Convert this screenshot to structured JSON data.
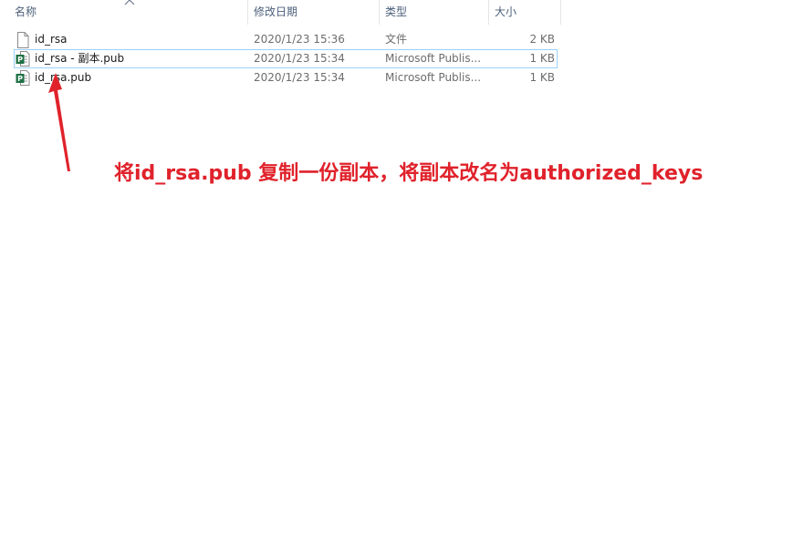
{
  "columns": {
    "name": "名称",
    "modified": "修改日期",
    "type": "类型",
    "size": "大小"
  },
  "files": [
    {
      "name": "id_rsa",
      "modified": "2020/1/23 15:36",
      "type": "文件",
      "size": "2 KB",
      "icon": "generic-file-icon",
      "selected": false
    },
    {
      "name": "id_rsa - 副本.pub",
      "modified": "2020/1/23 15:34",
      "type": "Microsoft Publis...",
      "size": "1 KB",
      "icon": "publisher-file-icon",
      "selected": true
    },
    {
      "name": "id_rsa.pub",
      "modified": "2020/1/23 15:34",
      "type": "Microsoft Publis...",
      "size": "1 KB",
      "icon": "publisher-file-icon",
      "selected": false
    }
  ],
  "annotation": {
    "text": "将id_rsa.pub 复制一份副本，将副本改名为authorized_keys",
    "color": "#e0222b"
  },
  "colors": {
    "header_text": "#4c607a",
    "selection_border": "#99d1ff",
    "publisher_green": "#1e7145"
  }
}
